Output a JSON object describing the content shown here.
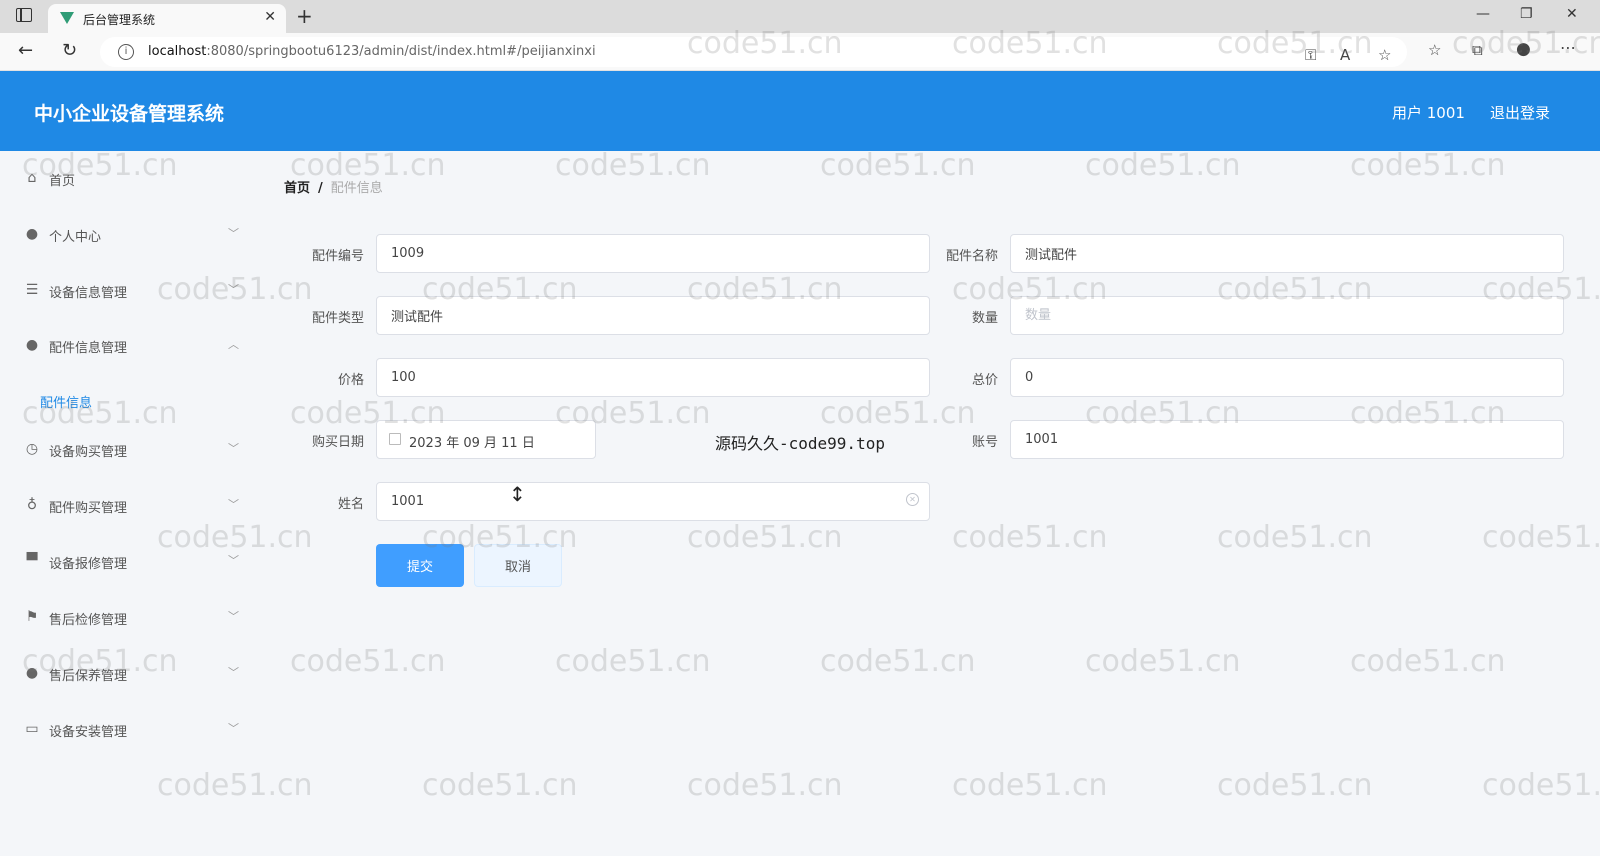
{
  "browser": {
    "tab_title": "后台管理系统",
    "url_host": "localhost",
    "url_rest": ":8080/springbootu6123/admin/dist/index.html#/peijianxinxi"
  },
  "header": {
    "title": "中小企业设备管理系统",
    "user": "用户 1001",
    "logout": "退出登录"
  },
  "sidebar": {
    "items": [
      {
        "label": "首页",
        "icon": "home-icon"
      },
      {
        "label": "个人中心",
        "icon": "user-icon"
      },
      {
        "label": "设备信息管理",
        "icon": "list-icon"
      },
      {
        "label": "配件信息管理",
        "icon": "user-icon"
      },
      {
        "label": "设备购买管理",
        "icon": "clock-icon"
      },
      {
        "label": "配件购买管理",
        "icon": "microphone-icon"
      },
      {
        "label": "设备报修管理",
        "icon": "flag-icon"
      },
      {
        "label": "售后检修管理",
        "icon": "flag-icon"
      },
      {
        "label": "售后保养管理",
        "icon": "bulb-icon"
      },
      {
        "label": "设备安装管理",
        "icon": "message-icon"
      }
    ],
    "active_sub": "配件信息"
  },
  "breadcrumb": {
    "home": "首页",
    "sep": "/",
    "current": "配件信息"
  },
  "form": {
    "code_label": "配件编号",
    "code_value": "1009",
    "name_label": "配件名称",
    "name_value": "测试配件",
    "type_label": "配件类型",
    "type_value": "测试配件",
    "qty_label": "数量",
    "qty_placeholder": "数量",
    "price_label": "价格",
    "price_value": "100",
    "total_label": "总价",
    "total_value": "0",
    "date_label": "购买日期",
    "date_value": "2023 年 09 月 11 日",
    "account_label": "账号",
    "account_value": "1001",
    "person_label": "姓名",
    "person_value": "1001",
    "submit": "提交",
    "cancel": "取消"
  },
  "watermark": {
    "center": "源码久久-code99.top",
    "repeat": "code51.cn"
  }
}
